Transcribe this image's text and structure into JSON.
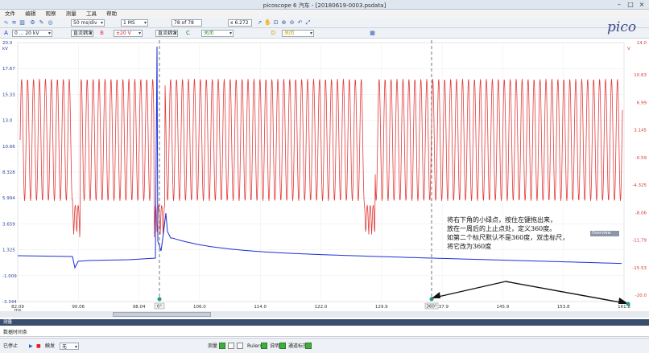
{
  "window": {
    "title": "picoscope 6 汽车 - [20180619-0003.psdata]"
  },
  "menu": [
    "文件",
    "编辑",
    "观察",
    "测量",
    "工具",
    "帮助"
  ],
  "toolbar1": {
    "timebase": "50 ms/div",
    "samples": "1 MS",
    "buffer": "78 of 78",
    "zoom": "x 6.272"
  },
  "toolbar2": {
    "channel_a_range": "0 ... 20 kV",
    "channel_a_coupling": "直流耦合",
    "channel_b_range": "±20 V",
    "channel_b_coupling": "直流耦合",
    "channel_c": "关闭",
    "channel_d": "关闭"
  },
  "logo": "pico",
  "axes": {
    "left_unit": "kV",
    "left_ticks": [
      "20.0",
      "17.67",
      "15.33",
      "13.0",
      "10.66",
      "8.328",
      "5.994",
      "3.659",
      "1.325",
      "-1.009",
      "-3.344"
    ],
    "right_unit": "V",
    "right_ticks": [
      "14.0",
      "10.63",
      "6.99",
      "3.145",
      "-0.59",
      "-4.325",
      "-8.06",
      "-11.79",
      "-15.53",
      "-20.0"
    ],
    "x_ticks": [
      "82.09",
      "90.06",
      "98.04",
      "106.0",
      "114.0",
      "122.0",
      "129.9",
      "137.9",
      "145.9",
      "153.8",
      "161.8"
    ],
    "x_unit": "ms"
  },
  "rulers": {
    "left_label": "0°",
    "right_label": "360°"
  },
  "annotation": [
    "将右下角的小绿点，按住左键拖出来，",
    "放在一周后的上止点处，定义360度。",
    "如第二个标尺默认不是360度，双击标尺，",
    "将它改为360度"
  ],
  "overview_label": "Overview",
  "panel": {
    "header": "测量",
    "body": "数据时间条"
  },
  "statusbar": {
    "state": "已停止",
    "trigger_label": "触发",
    "trigger_value": "无",
    "measure_label": "测量",
    "rulers_label": "Rulers",
    "notes_label": "说明",
    "channel_label": "通道标签"
  },
  "colors": {
    "channel_a": "#1b2fd6",
    "channel_b": "#e23b3b",
    "panel_header": "#3a4e6e"
  }
}
